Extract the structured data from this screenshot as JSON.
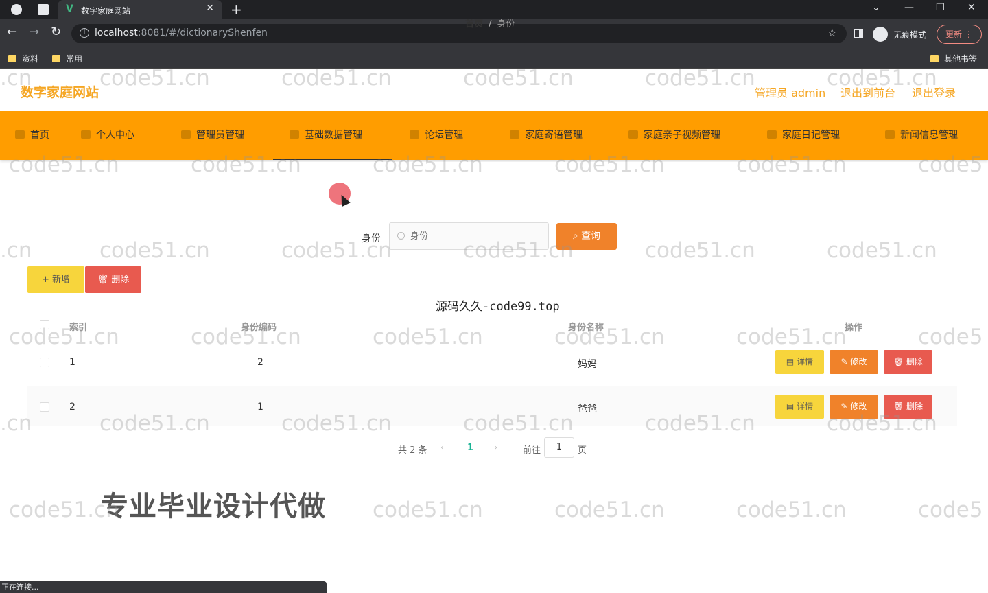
{
  "browser": {
    "tab_title": "数字家庭网站",
    "url_host": "localhost",
    "url_rest": ":8081/#/dictionaryShenfen",
    "incognito_label": "无痕模式",
    "update_label": "更新",
    "bookmarks": [
      "资料",
      "常用"
    ],
    "other_bookmarks": "其他书签",
    "status_text": "正在连接..."
  },
  "header": {
    "site_title": "数字家庭网站",
    "user": "管理员 admin",
    "to_front": "退出到前台",
    "logout": "退出登录"
  },
  "nav": {
    "items": [
      "首页",
      "个人中心",
      "管理员管理",
      "基础数据管理",
      "论坛管理",
      "家庭寄语管理",
      "家庭亲子视频管理",
      "家庭日记管理",
      "新闻信息管理"
    ],
    "active_index": 3
  },
  "breadcrumb": {
    "home": "首页",
    "separator": "/",
    "current": "身份"
  },
  "search": {
    "label": "身份",
    "placeholder": "身份",
    "button": "查询"
  },
  "actions": {
    "add": "新增",
    "delete": "删除"
  },
  "overlay_text": "源码久久-code99.top",
  "table": {
    "headers": [
      "索引",
      "身份编码",
      "身份名称",
      "操作"
    ],
    "rows": [
      {
        "index": "1",
        "code": "2",
        "name": "妈妈"
      },
      {
        "index": "2",
        "code": "1",
        "name": "爸爸"
      }
    ],
    "row_buttons": {
      "detail": "详情",
      "edit": "修改",
      "delete": "删除"
    }
  },
  "pagination": {
    "total": "共 2 条",
    "current_page": "1",
    "goto_label": "前往",
    "goto_value": "1",
    "page_suffix": "页"
  },
  "promo_text": "专业毕业设计代做",
  "watermark": "code51.cn",
  "colors": {
    "accent": "#ff9d00",
    "title": "#f5a623",
    "search_btn": "#f0822a",
    "add_btn": "#f7d53c",
    "delete_btn": "#e85a4f"
  }
}
